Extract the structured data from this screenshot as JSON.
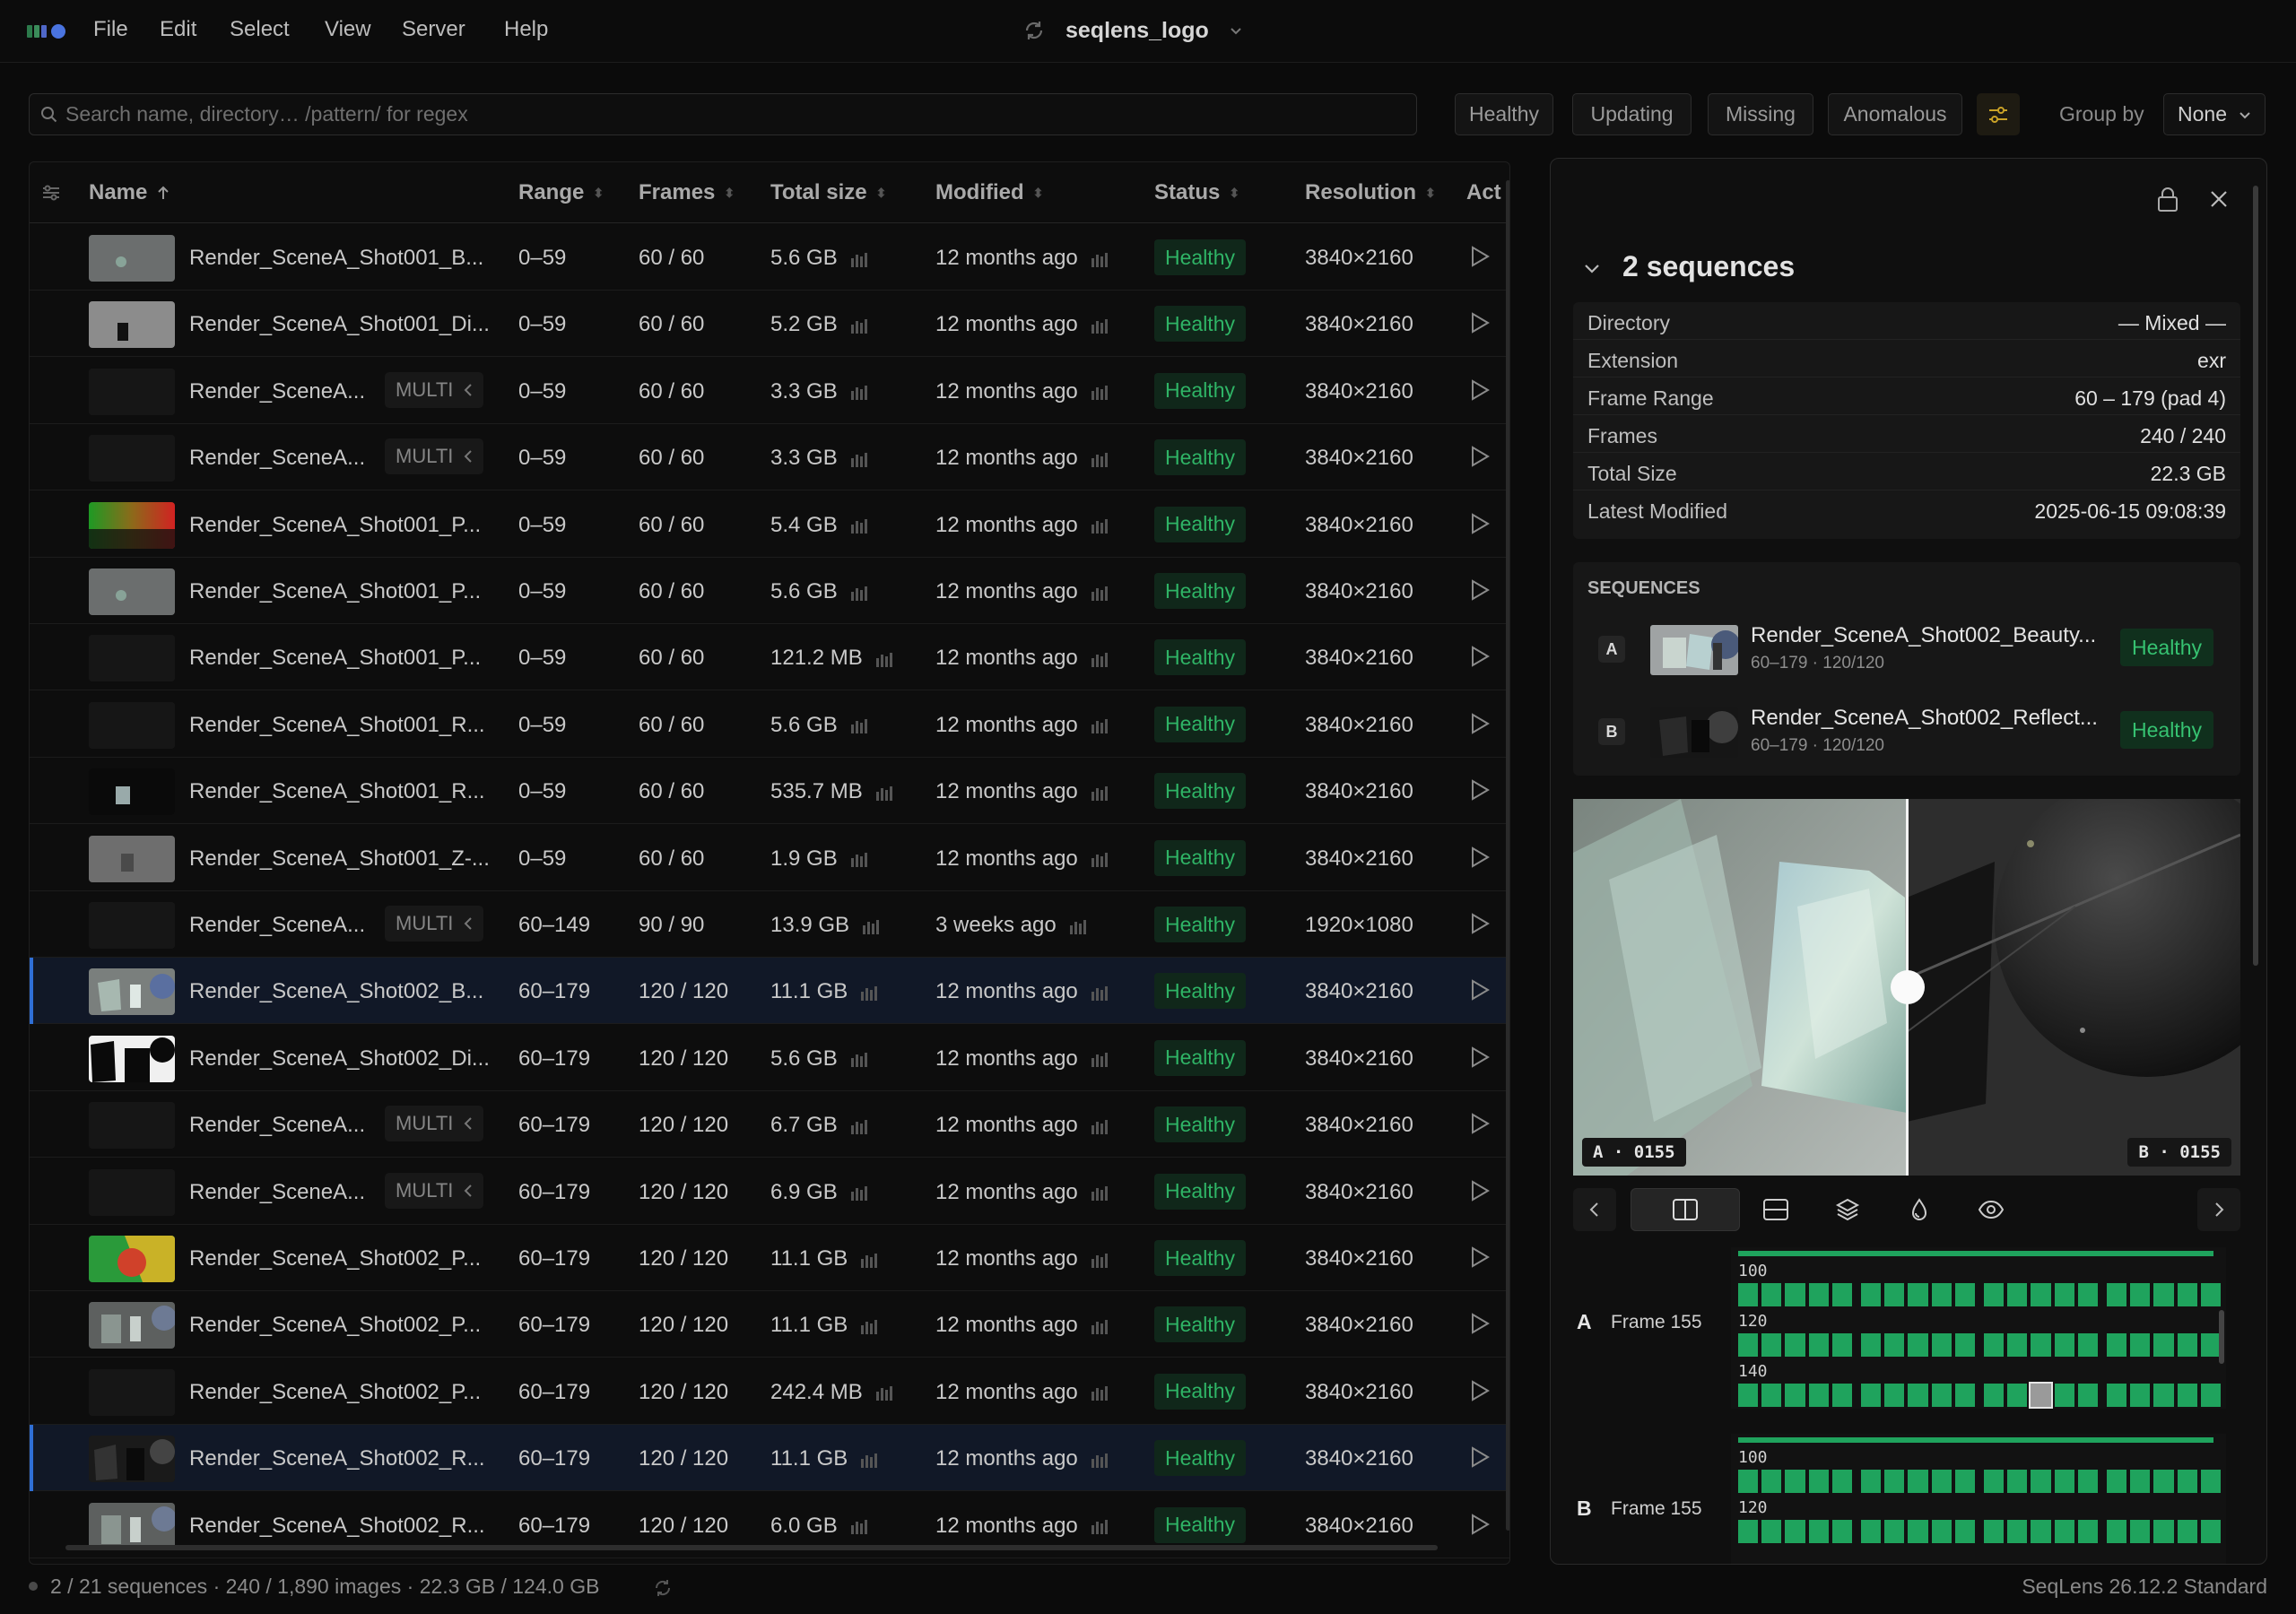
{
  "menubar": {
    "items": [
      "File",
      "Edit",
      "Select",
      "View",
      "Server",
      "Help"
    ],
    "project_title": "seqlens_logo"
  },
  "toolbar": {
    "search_placeholder": "Search name, directory… /pattern/ for regex",
    "filters": [
      "Healthy",
      "Updating",
      "Missing",
      "Anomalous"
    ],
    "group_by_label": "Group by",
    "group_by_value": "None"
  },
  "table": {
    "columns": [
      "Name",
      "Range",
      "Frames",
      "Total size",
      "Modified",
      "Status",
      "Resolution",
      "Act"
    ],
    "rows": [
      {
        "name": "Render_SceneA_Shot001_B...",
        "multi": "",
        "range": "0–59",
        "frames": "60 / 60",
        "size": "5.6 GB",
        "modified": "12 months ago",
        "status": "Healthy",
        "resolution": "3840×2160",
        "selected": false,
        "thumb": "gray"
      },
      {
        "name": "Render_SceneA_Shot001_Di...",
        "multi": "",
        "range": "0–59",
        "frames": "60 / 60",
        "size": "5.2 GB",
        "modified": "12 months ago",
        "status": "Healthy",
        "resolution": "3840×2160",
        "selected": false,
        "thumb": "gray-dark-object"
      },
      {
        "name": "Render_SceneA...",
        "multi": "MULTI",
        "range": "0–59",
        "frames": "60 / 60",
        "size": "3.3 GB",
        "modified": "12 months ago",
        "status": "Healthy",
        "resolution": "3840×2160",
        "selected": false,
        "thumb": "dark"
      },
      {
        "name": "Render_SceneA...",
        "multi": "MULTI",
        "range": "0–59",
        "frames": "60 / 60",
        "size": "3.3 GB",
        "modified": "12 months ago",
        "status": "Healthy",
        "resolution": "3840×2160",
        "selected": false,
        "thumb": "dark"
      },
      {
        "name": "Render_SceneA_Shot001_P...",
        "multi": "",
        "range": "0–59",
        "frames": "60 / 60",
        "size": "5.4 GB",
        "modified": "12 months ago",
        "status": "Healthy",
        "resolution": "3840×2160",
        "selected": false,
        "thumb": "rgb"
      },
      {
        "name": "Render_SceneA_Shot001_P...",
        "multi": "",
        "range": "0–59",
        "frames": "60 / 60",
        "size": "5.6 GB",
        "modified": "12 months ago",
        "status": "Healthy",
        "resolution": "3840×2160",
        "selected": false,
        "thumb": "gray"
      },
      {
        "name": "Render_SceneA_Shot001_P...",
        "multi": "",
        "range": "0–59",
        "frames": "60 / 60",
        "size": "121.2 MB",
        "modified": "12 months ago",
        "status": "Healthy",
        "resolution": "3840×2160",
        "selected": false,
        "thumb": "dark"
      },
      {
        "name": "Render_SceneA_Shot001_R...",
        "multi": "",
        "range": "0–59",
        "frames": "60 / 60",
        "size": "5.6 GB",
        "modified": "12 months ago",
        "status": "Healthy",
        "resolution": "3840×2160",
        "selected": false,
        "thumb": "dark"
      },
      {
        "name": "Render_SceneA_Shot001_R...",
        "multi": "",
        "range": "0–59",
        "frames": "60 / 60",
        "size": "535.7 MB",
        "modified": "12 months ago",
        "status": "Healthy",
        "resolution": "3840×2160",
        "selected": false,
        "thumb": "black-object"
      },
      {
        "name": "Render_SceneA_Shot001_Z-...",
        "multi": "",
        "range": "0–59",
        "frames": "60 / 60",
        "size": "1.9 GB",
        "modified": "12 months ago",
        "status": "Healthy",
        "resolution": "3840×2160",
        "selected": false,
        "thumb": "gray-object"
      },
      {
        "name": "Render_SceneA...",
        "multi": "MULTI",
        "range": "60–149",
        "frames": "90 / 90",
        "size": "13.9 GB",
        "modified": "3 weeks ago",
        "status": "Healthy",
        "resolution": "1920×1080",
        "selected": false,
        "thumb": "dark"
      },
      {
        "name": "Render_SceneA_Shot002_B...",
        "multi": "",
        "range": "60–179",
        "frames": "120 / 120",
        "size": "11.1 GB",
        "modified": "12 months ago",
        "status": "Healthy",
        "resolution": "3840×2160",
        "selected": true,
        "thumb": "beauty"
      },
      {
        "name": "Render_SceneA_Shot002_Di...",
        "multi": "",
        "range": "60–179",
        "frames": "120 / 120",
        "size": "5.6 GB",
        "modified": "12 months ago",
        "status": "Healthy",
        "resolution": "3840×2160",
        "selected": false,
        "thumb": "white-black"
      },
      {
        "name": "Render_SceneA...",
        "multi": "MULTI",
        "range": "60–179",
        "frames": "120 / 120",
        "size": "6.7 GB",
        "modified": "12 months ago",
        "status": "Healthy",
        "resolution": "3840×2160",
        "selected": false,
        "thumb": "dark"
      },
      {
        "name": "Render_SceneA...",
        "multi": "MULTI",
        "range": "60–179",
        "frames": "120 / 120",
        "size": "6.9 GB",
        "modified": "12 months ago",
        "status": "Healthy",
        "resolution": "3840×2160",
        "selected": false,
        "thumb": "dark"
      },
      {
        "name": "Render_SceneA_Shot002_P...",
        "multi": "",
        "range": "60–179",
        "frames": "120 / 120",
        "size": "11.1 GB",
        "modified": "12 months ago",
        "status": "Healthy",
        "resolution": "3840×2160",
        "selected": false,
        "thumb": "rgb2"
      },
      {
        "name": "Render_SceneA_Shot002_P...",
        "multi": "",
        "range": "60–179",
        "frames": "120 / 120",
        "size": "11.1 GB",
        "modified": "12 months ago",
        "status": "Healthy",
        "resolution": "3840×2160",
        "selected": false,
        "thumb": "beauty-gray"
      },
      {
        "name": "Render_SceneA_Shot002_P...",
        "multi": "",
        "range": "60–179",
        "frames": "120 / 120",
        "size": "242.4 MB",
        "modified": "12 months ago",
        "status": "Healthy",
        "resolution": "3840×2160",
        "selected": false,
        "thumb": "dark"
      },
      {
        "name": "Render_SceneA_Shot002_R...",
        "multi": "",
        "range": "60–179",
        "frames": "120 / 120",
        "size": "11.1 GB",
        "modified": "12 months ago",
        "status": "Healthy",
        "resolution": "3840×2160",
        "selected": true,
        "thumb": "reflect"
      },
      {
        "name": "Render_SceneA_Shot002_R...",
        "multi": "",
        "range": "60–179",
        "frames": "120 / 120",
        "size": "6.0 GB",
        "modified": "12 months ago",
        "status": "Healthy",
        "resolution": "3840×2160",
        "selected": false,
        "thumb": "beauty-gray"
      }
    ]
  },
  "panel": {
    "title": "2 sequences",
    "properties": [
      {
        "key": "Directory",
        "value": "— Mixed —"
      },
      {
        "key": "Extension",
        "value": "exr"
      },
      {
        "key": "Frame Range",
        "value": "60 – 179 (pad 4)"
      },
      {
        "key": "Frames",
        "value": "240 / 240"
      },
      {
        "key": "Total Size",
        "value": "22.3 GB"
      },
      {
        "key": "Latest Modified",
        "value": "2025-06-15 09:08:39"
      }
    ],
    "sequences_header": "SEQUENCES",
    "sequences": [
      {
        "slot": "A",
        "name": "Render_SceneA_Shot002_Beauty...",
        "meta": "60–179 · 120/120",
        "status": "Healthy"
      },
      {
        "slot": "B",
        "name": "Render_SceneA_Shot002_Reflect...",
        "meta": "60–179 · 120/120",
        "status": "Healthy"
      }
    ],
    "viewer": {
      "label_a": "A · 0155",
      "label_b": "B · 0155",
      "split_fraction": 0.5
    },
    "timelines": [
      {
        "slot": "A",
        "frame": "Frame 155",
        "rows": [
          "100",
          "120",
          "140"
        ],
        "current_row": 2,
        "current_cell": 12
      },
      {
        "slot": "B",
        "frame": "Frame 155",
        "rows": [
          "100",
          "120"
        ]
      }
    ]
  },
  "footer": {
    "stats": "2 / 21 sequences · 240 / 1,890 images · 22.3 GB / 124.0 GB",
    "version": "SeqLens 26.12.2 Standard"
  },
  "colors": {
    "healthy": "#2fb466",
    "selection": "#2f6fd6",
    "accent": "#c9a227",
    "frame_cell": "#1fa35d"
  }
}
